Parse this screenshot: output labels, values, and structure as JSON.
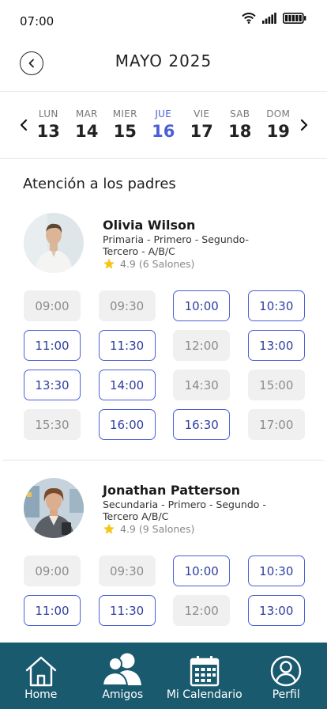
{
  "status": {
    "time": "07:00"
  },
  "header": {
    "title": "MAYO 2025"
  },
  "week": {
    "days": [
      {
        "name": "LUN",
        "num": "13"
      },
      {
        "name": "MAR",
        "num": "14"
      },
      {
        "name": "MIER",
        "num": "15"
      },
      {
        "name": "JUE",
        "num": "16"
      },
      {
        "name": "VIE",
        "num": "17"
      },
      {
        "name": "SAB",
        "num": "18"
      },
      {
        "name": "DOM",
        "num": "19"
      }
    ],
    "selected_index": 3
  },
  "section_title": "Atención a los padres",
  "teachers": [
    {
      "name": "Olivia Wilson",
      "subtitle": "Primaria - Primero - Segundo- Tercero - A/B/C",
      "rating": "4.9 (6 Salones)",
      "slots": [
        {
          "time": "09:00",
          "available": false
        },
        {
          "time": "09:30",
          "available": false
        },
        {
          "time": "10:00",
          "available": true
        },
        {
          "time": "10:30",
          "available": true
        },
        {
          "time": "11:00",
          "available": true
        },
        {
          "time": "11:30",
          "available": true
        },
        {
          "time": "12:00",
          "available": false
        },
        {
          "time": "13:00",
          "available": true
        },
        {
          "time": "13:30",
          "available": true
        },
        {
          "time": "14:00",
          "available": true
        },
        {
          "time": "14:30",
          "available": false
        },
        {
          "time": "15:00",
          "available": false
        },
        {
          "time": "15:30",
          "available": false
        },
        {
          "time": "16:00",
          "available": true
        },
        {
          "time": "16:30",
          "available": true
        },
        {
          "time": "17:00",
          "available": false
        }
      ]
    },
    {
      "name": "Jonathan Patterson",
      "subtitle": "Secundaria - Primero - Segundo - Tercero A/B/C",
      "rating": "4.9 (9 Salones)",
      "slots": [
        {
          "time": "09:00",
          "available": false
        },
        {
          "time": "09:30",
          "available": false
        },
        {
          "time": "10:00",
          "available": true
        },
        {
          "time": "10:30",
          "available": true
        },
        {
          "time": "11:00",
          "available": true
        },
        {
          "time": "11:30",
          "available": true
        },
        {
          "time": "12:00",
          "available": false
        },
        {
          "time": "13:00",
          "available": true
        }
      ]
    }
  ],
  "nav": {
    "home": "Home",
    "friends": "Amigos",
    "calendar": "Mi Calendario",
    "profile": "Perfil"
  },
  "colors": {
    "accent": "#4b5fd5",
    "nav_bg": "#1a5a6f",
    "star": "#f5c518"
  }
}
